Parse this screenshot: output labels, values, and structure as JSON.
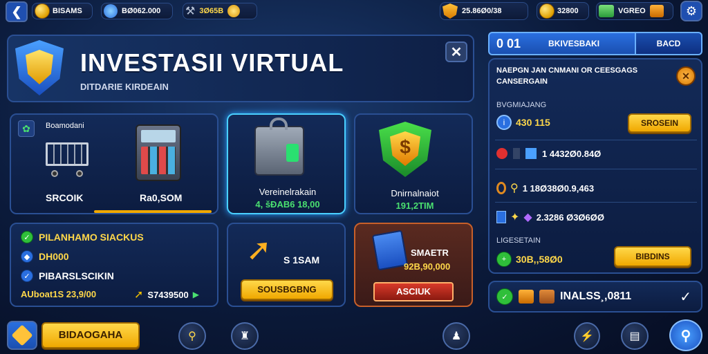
{
  "topbar": {
    "back_icon": "back-arrow-icon",
    "currency1_label": "BISAMS",
    "currency2_value": "BØ062.000",
    "currency3_value": "3Ø65B",
    "right1_value": "25.86Ø0/38",
    "right2_value": "32800",
    "right3_label": "VGREO"
  },
  "header": {
    "title": "INVESTASII VIRTUAL",
    "subtitle": "DITDARIE KIRDEAIN"
  },
  "cards": {
    "card1_header": "Boamodani",
    "card1_label_left": "SRCOIK",
    "card1_label_right": "Ra0,SOM",
    "card2_label": "Vereinelrakain",
    "card2_value": "4, šĐAB6 18,00",
    "card3_label": "Dnirnalnaiot",
    "card3_value": "191,2TIM"
  },
  "list": {
    "item1": "PILANHAMO SIACKUS",
    "item2": "DH000",
    "item3": "PIBARSLSCIKIN",
    "footer_left": "AUboat1S 23,9/00",
    "footer_right": "S7439500"
  },
  "actions": {
    "box1_value": "S 1SAM",
    "box1_button": "SOUSBGBNG",
    "box2_label": "SMAETR",
    "box2_value": "92B,90,000",
    "box2_button": "ASCIUK"
  },
  "right_panel": {
    "tab_id": "0 01",
    "tab_label": "BKIVESBAKI",
    "tab_right": "BACD",
    "notice_line1": "NAEPGN JAN CNMANI OR CEESGAGS",
    "notice_line2": "CANSERGAIN",
    "section1_title": "BVGMIAJANG",
    "section1_value": "430 115",
    "section1_button": "SROSEIN",
    "row1_value": "1 4432Ø0.84Ø",
    "row2_value": "1 18Ø38Ø0.9,463",
    "row3_value": "2.3286 Ø3Ø6ØØ",
    "section2_title": "LIGESETAIN",
    "section2_value": "30B,,58Ø0",
    "section2_button": "BIBDINS",
    "footer_label": "INALSS¸,0811"
  },
  "bottombar": {
    "left_button": "BIDAOGAHA"
  },
  "colors": {
    "accent_gold": "#f0a800",
    "accent_blue": "#2a6fe0",
    "panel_bg": "#132a58"
  }
}
